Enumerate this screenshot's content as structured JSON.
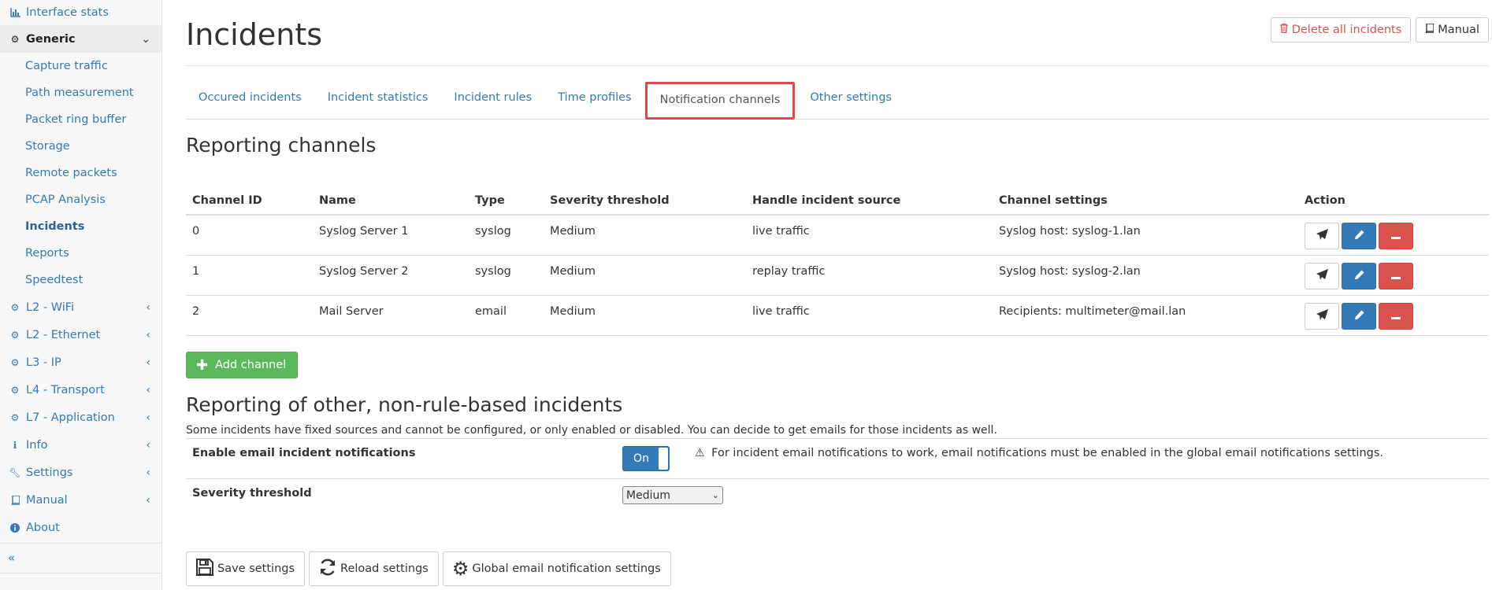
{
  "sidebar": {
    "top_item": {
      "label": "Interface stats",
      "icon": "bar-chart-icon"
    },
    "generic": {
      "label": "Generic",
      "items": [
        "Capture traffic",
        "Path measurement",
        "Packet ring buffer",
        "Storage",
        "Remote packets",
        "PCAP Analysis",
        "Incidents",
        "Reports",
        "Speedtest"
      ],
      "active": "Incidents"
    },
    "groups": [
      {
        "label": "L2 - WiFi",
        "icon": "gear-icon"
      },
      {
        "label": "L2 - Ethernet",
        "icon": "gear-icon"
      },
      {
        "label": "L3 - IP",
        "icon": "gear-icon"
      },
      {
        "label": "L4 - Transport",
        "icon": "gear-icon"
      },
      {
        "label": "L7 - Application",
        "icon": "gear-icon"
      },
      {
        "label": "Info",
        "icon": "info-icon"
      },
      {
        "label": "Settings",
        "icon": "wrench-icon"
      },
      {
        "label": "Manual",
        "icon": "book-icon"
      }
    ],
    "about": "About",
    "collapse": "«"
  },
  "header": {
    "title": "Incidents",
    "delete_all": "Delete all incidents",
    "manual": "Manual"
  },
  "tabs": [
    "Occured incidents",
    "Incident statistics",
    "Incident rules",
    "Time profiles",
    "Notification channels",
    "Other settings"
  ],
  "active_tab": "Notification channels",
  "reporting_channels": {
    "title": "Reporting channels",
    "columns": [
      "Channel ID",
      "Name",
      "Type",
      "Severity threshold",
      "Handle incident source",
      "Channel settings",
      "Action"
    ],
    "rows": [
      {
        "id": "0",
        "name": "Syslog Server 1",
        "type": "syslog",
        "severity": "Medium",
        "source": "live traffic",
        "settings": "Syslog host: syslog-1.lan"
      },
      {
        "id": "1",
        "name": "Syslog Server 2",
        "type": "syslog",
        "severity": "Medium",
        "source": "replay traffic",
        "settings": "Syslog host: syslog-2.lan"
      },
      {
        "id": "2",
        "name": "Mail Server",
        "type": "email",
        "severity": "Medium",
        "source": "live traffic",
        "settings": "Recipients: multimeter@mail.lan"
      }
    ],
    "add_button": "Add channel"
  },
  "other_incidents": {
    "title": "Reporting of other, non-rule-based incidents",
    "description": "Some incidents have fixed sources and cannot be configured, or only enabled or disabled. You can decide to get emails for those incidents as well.",
    "email_label": "Enable email incident notifications",
    "toggle_label": "On",
    "warning": "For incident email notifications to work, email notifications must be enabled in the global email notifications settings.",
    "severity_label": "Severity threshold",
    "severity_value": "Medium"
  },
  "footer": {
    "save": "Save settings",
    "reload": "Reload settings",
    "global_email": "Global email notification settings"
  },
  "colors": {
    "link": "#337ab7",
    "danger": "#d9534f",
    "success": "#5cb85c",
    "highlight_border": "#e0474c"
  }
}
